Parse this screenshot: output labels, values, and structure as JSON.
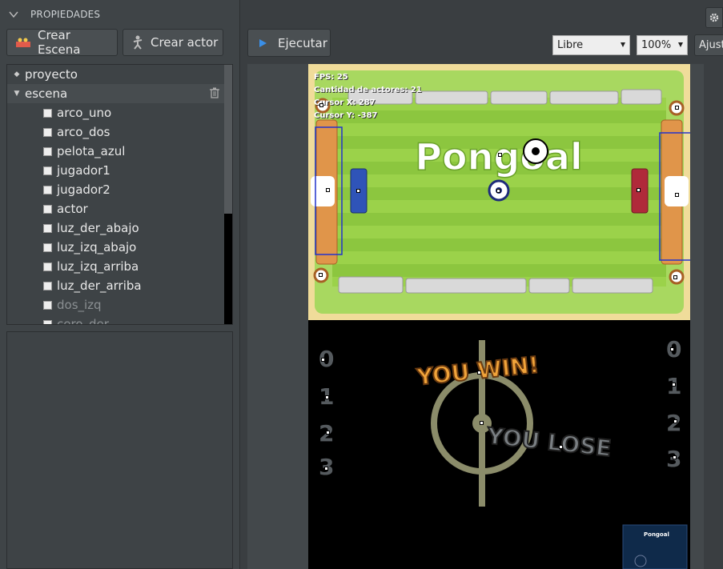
{
  "sidebar": {
    "section_title": "PROPIEDADES",
    "create_scene_label": "Crear Escena",
    "create_actor_label": "Crear actor",
    "tree": {
      "root_label": "proyecto",
      "scene_label": "escena",
      "actors": [
        "arco_uno",
        "arco_dos",
        "pelota_azul",
        "jugador1",
        "jugador2",
        "actor",
        "luz_der_abajo",
        "luz_izq_abajo",
        "luz_izq_arriba",
        "luz_der_arriba",
        "dos_izq",
        "cero_der"
      ]
    }
  },
  "toolbar": {
    "run_label": "Ejecutar",
    "camera_mode": "Libre",
    "zoom": "100%",
    "fit_label": "Ajust"
  },
  "game": {
    "title_text": "Pongoal",
    "hud": {
      "fps": "FPS: 25",
      "actors": "Cantidad de actores: 21",
      "cursor_x": "Cursor X: 287",
      "cursor_y": "Cursor Y: -387"
    },
    "win_text": "YOU WIN!",
    "lose_text": "YOU LOSE",
    "score_left": [
      "0",
      "1",
      "2",
      "3"
    ],
    "score_right": [
      "0",
      "1",
      "2",
      "3"
    ],
    "thumbnail_text": "Pongoal"
  },
  "colors": {
    "accent": "#3a8fe8",
    "field_green": "#8cc63f",
    "panel_bg": "#3f4447"
  }
}
